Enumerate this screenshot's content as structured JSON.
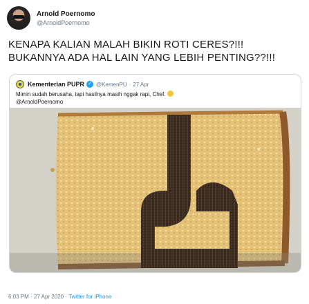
{
  "author": {
    "display_name": "Arnold Poernomo",
    "handle": "@ArnoldPoernomo"
  },
  "tweet": {
    "line1": "KENAPA KALIAN MALAH BIKIN ROTI CERES?!!!",
    "line2": "BUKANNYA ADA HAL LAIN YANG LEBIH PENTING??!!!"
  },
  "quoted": {
    "name": "Kementerian PUPR",
    "handle": "@KemenPU",
    "separator": "·",
    "date": "27 Apr",
    "text": "Mimin sudah berusaha, tapi hasilnya masih nggak rapi, Chef.",
    "mention": "@ArnoldPoernomo",
    "emoji": "crying-face-icon",
    "verified_icon": "verified-badge-icon"
  },
  "meta": {
    "time": "6:03 PM",
    "separator": "·",
    "date": "27 Apr 2020",
    "dot": "·",
    "source": "Twitter for iPhone"
  },
  "colors": {
    "text": "#14171a",
    "secondary": "#657786",
    "link": "#1b95e0",
    "verified": "#1da1f2",
    "border": "#ccd6dd",
    "bread": "#e3c176",
    "chocolate_sprinkles": "#3b2a1d"
  }
}
